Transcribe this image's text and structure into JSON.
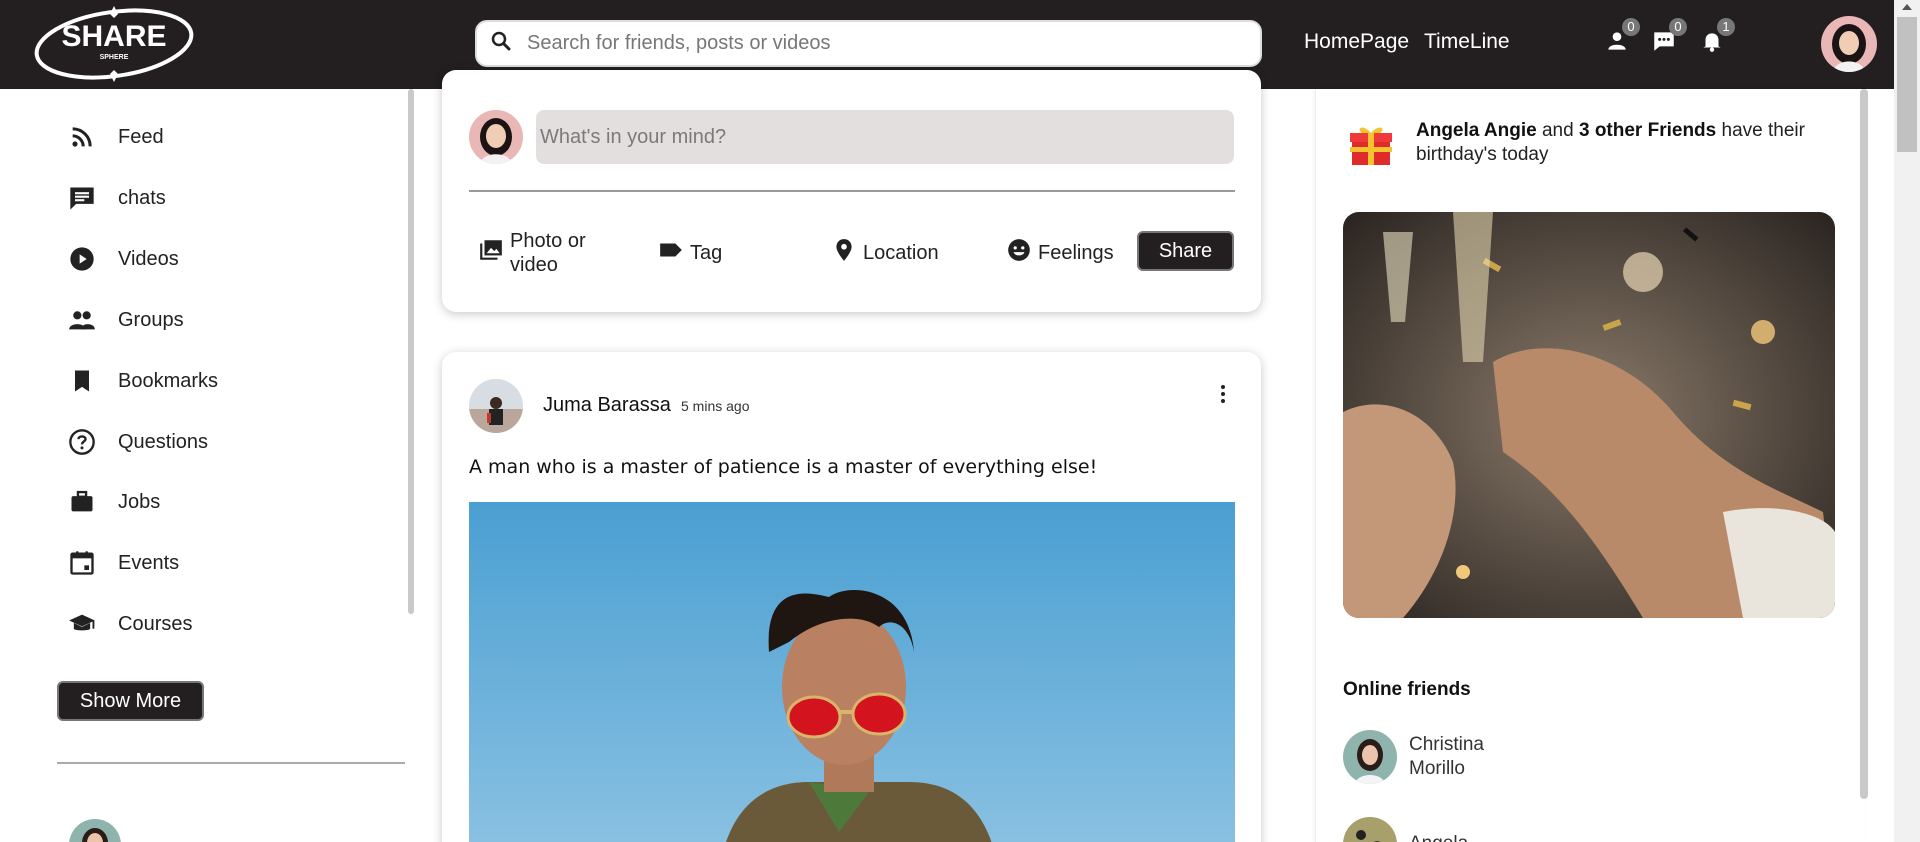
{
  "header": {
    "logo_text": "SHARE",
    "logo_subtext": "SPHERE",
    "search_placeholder": "Search for friends, posts or videos",
    "nav_links": [
      {
        "label": "HomePage"
      },
      {
        "label": "TimeLine"
      }
    ],
    "notifications": {
      "friends_count": "0",
      "messages_count": "0",
      "alerts_count": "1"
    }
  },
  "sidebar": {
    "items": [
      {
        "label": "Feed",
        "icon": "rss-feed-icon"
      },
      {
        "label": "chats",
        "icon": "chat-icon"
      },
      {
        "label": "Videos",
        "icon": "play-circle-icon"
      },
      {
        "label": "Groups",
        "icon": "group-icon"
      },
      {
        "label": "Bookmarks",
        "icon": "bookmark-icon"
      },
      {
        "label": "Questions",
        "icon": "help-circle-icon"
      },
      {
        "label": "Jobs",
        "icon": "briefcase-icon"
      },
      {
        "label": "Events",
        "icon": "calendar-icon"
      },
      {
        "label": "Courses",
        "icon": "graduation-cap-icon"
      }
    ],
    "show_more_label": "Show More"
  },
  "composer": {
    "placeholder": "What's in your mind?",
    "options": [
      {
        "label": "Photo or video",
        "icon": "photo-library-icon"
      },
      {
        "label": "Tag",
        "icon": "tag-icon"
      },
      {
        "label": "Location",
        "icon": "location-pin-icon"
      },
      {
        "label": "Feelings",
        "icon": "smile-icon"
      }
    ],
    "share_label": "Share"
  },
  "post": {
    "author": "Juma Barassa",
    "time": "5 mins ago",
    "text": "A man who is a master of patience is a master of everything else!"
  },
  "rightbar": {
    "birthday": {
      "name": "Angela Angie",
      "middle": " and ",
      "others": "3 other Friends",
      "suffix": " have their birthday's today"
    },
    "online_title": "Online friends",
    "online_friends": [
      {
        "name": "Christina Morillo"
      },
      {
        "name": "Angela"
      }
    ]
  },
  "colors": {
    "topbar": "#231f20",
    "accent_button": "#231f20",
    "composer_input_bg": "#e3dfde",
    "badge": "#777777"
  }
}
